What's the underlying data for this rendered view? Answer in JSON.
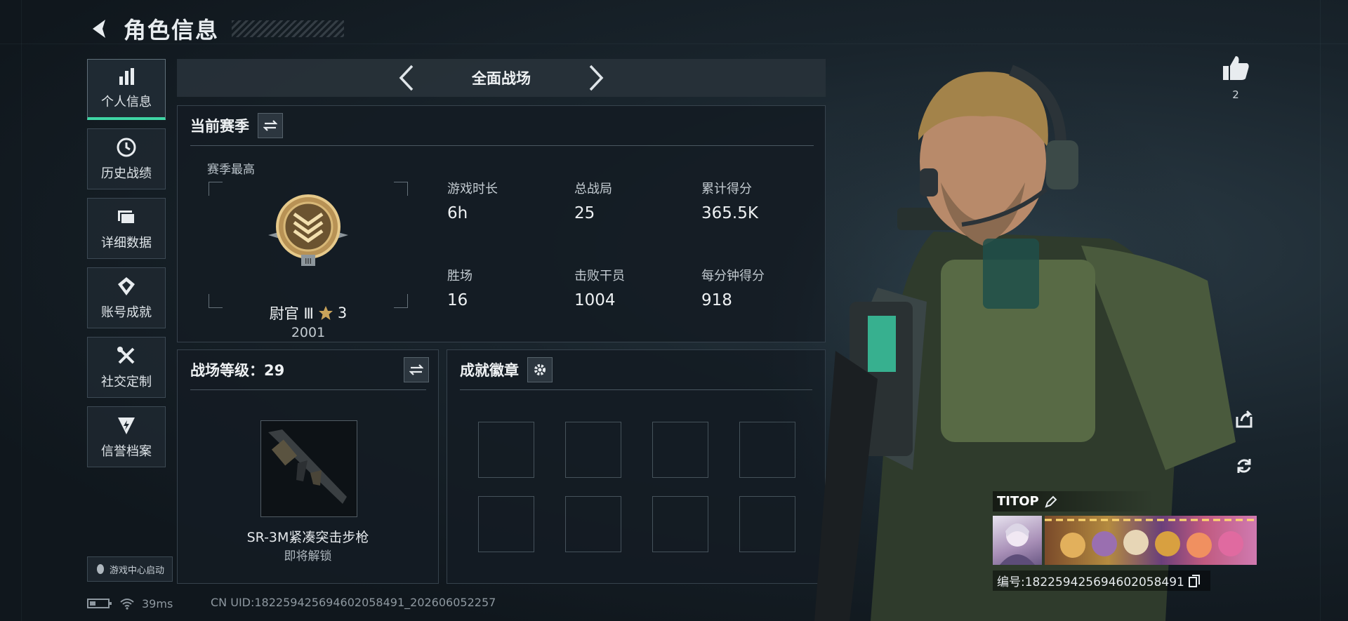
{
  "header": {
    "title": "角色信息"
  },
  "sidebar": {
    "items": [
      {
        "label": "个人信息",
        "icon": "bar-chart-icon",
        "active": true
      },
      {
        "label": "历史战绩",
        "icon": "clock-icon",
        "active": false
      },
      {
        "label": "详细数据",
        "icon": "folder-icon",
        "active": false
      },
      {
        "label": "账号成就",
        "icon": "achievement-icon",
        "active": false
      },
      {
        "label": "社交定制",
        "icon": "tools-icon",
        "active": false
      },
      {
        "label": "信誉档案",
        "icon": "shield-lightning-icon",
        "active": false
      }
    ],
    "launch_label": "游戏中心启动"
  },
  "mode": {
    "title": "全面战场"
  },
  "season": {
    "title": "当前赛季",
    "best_label": "赛季最高",
    "rank_name": "尉官 Ⅲ",
    "rank_stars": "3",
    "rank_points": "2001",
    "stats": [
      {
        "label": "游戏时长",
        "value": "6h"
      },
      {
        "label": "总战局",
        "value": "25"
      },
      {
        "label": "累计得分",
        "value": "365.5K"
      },
      {
        "label": "胜场",
        "value": "16"
      },
      {
        "label": "击败干员",
        "value": "1004"
      },
      {
        "label": "每分钟得分",
        "value": "918"
      }
    ]
  },
  "level": {
    "title": "战场等级：29",
    "weapon_name": "SR-3M紧凑突击步枪",
    "weapon_status": "即将解锁"
  },
  "badges": {
    "title": "成就徽章",
    "slots": 8
  },
  "status": {
    "ping": "39ms",
    "uid": "CN UID:18225942569460205849​1_202606052257"
  },
  "profile": {
    "like_count": "2",
    "name": "TITOP",
    "id_text": "编号:18225942569460205849​1"
  },
  "colors": {
    "accent": "#3fd6a5",
    "panel": "#141c23",
    "gold": "#c9a35a"
  }
}
